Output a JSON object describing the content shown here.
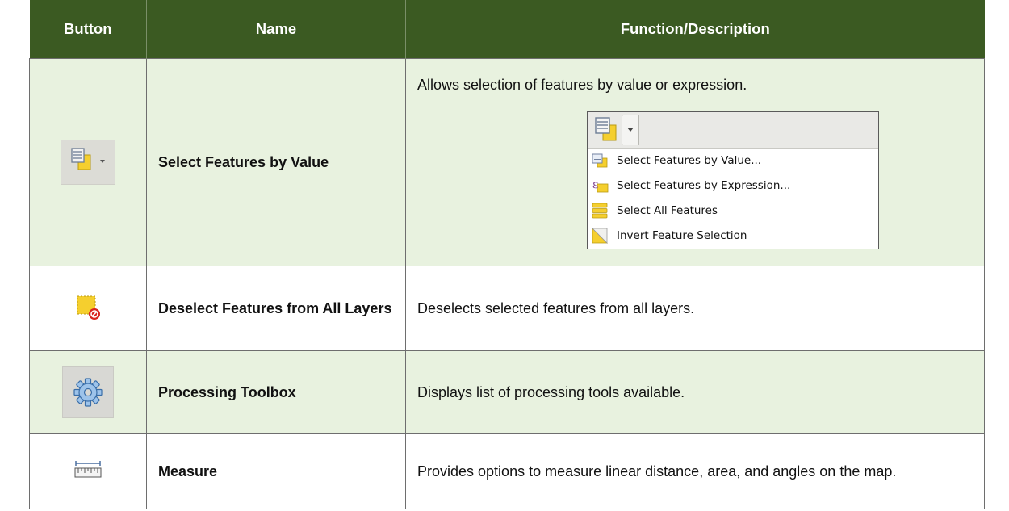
{
  "table": {
    "headers": {
      "button": "Button",
      "name": "Name",
      "description": "Function/Description"
    },
    "rows": [
      {
        "icon": "select-features-by-value-icon",
        "name": "Select Features by Value",
        "description": "Allows selection of features by value or expression.",
        "menu": {
          "items": [
            {
              "icon": "select-by-value-icon",
              "label": "Select Features by Value..."
            },
            {
              "icon": "select-by-expression-icon",
              "label": "Select Features by Expression..."
            },
            {
              "icon": "select-all-icon",
              "label": "Select All Features"
            },
            {
              "icon": "invert-selection-icon",
              "label": "Invert Feature Selection"
            }
          ]
        }
      },
      {
        "icon": "deselect-all-layers-icon",
        "name": "Deselect Features from All Layers",
        "description": "Deselects selected features from all layers."
      },
      {
        "icon": "processing-toolbox-gear-icon",
        "name": "Processing Toolbox",
        "description": "Displays list of processing tools available."
      },
      {
        "icon": "measure-ruler-icon",
        "name": "Measure",
        "description": "Provides options to measure linear distance, area, and angles on the map."
      }
    ]
  },
  "colors": {
    "header_bg": "#3b5a22",
    "row_shade": "#e8f2df",
    "select_yellow": "#f5cf2e"
  }
}
